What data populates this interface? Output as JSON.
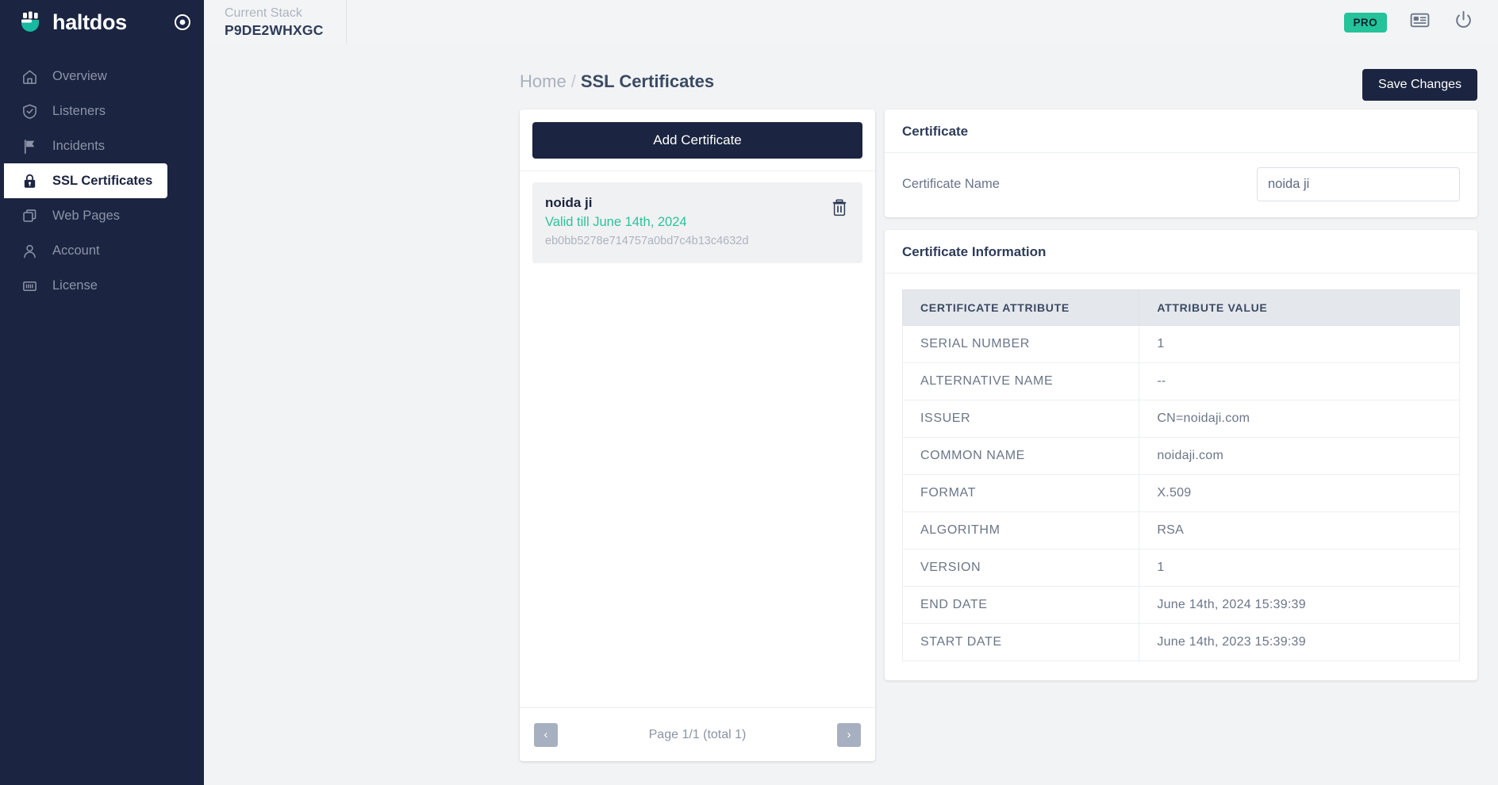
{
  "brand": {
    "name": "haltdos",
    "target_icon": "target-icon"
  },
  "sidebar": {
    "items": [
      {
        "label": "Overview",
        "icon": "home-icon",
        "active": false
      },
      {
        "label": "Listeners",
        "icon": "shield-check-icon",
        "active": false
      },
      {
        "label": "Incidents",
        "icon": "flag-icon",
        "active": false
      },
      {
        "label": "SSL Certificates",
        "icon": "lock-icon",
        "active": true
      },
      {
        "label": "Web Pages",
        "icon": "windows-icon",
        "active": false
      },
      {
        "label": "Account",
        "icon": "person-icon",
        "active": false
      },
      {
        "label": "License",
        "icon": "id-card-icon",
        "active": false
      }
    ]
  },
  "topbar": {
    "stack_label": "Current Stack",
    "stack_value": "P9DE2WHXGC",
    "pro_badge": "PRO",
    "icons": [
      "id-card-icon",
      "power-icon"
    ]
  },
  "breadcrumb": {
    "home": "Home",
    "separator": "/",
    "current": "SSL Certificates"
  },
  "cert_panel": {
    "add_button": "Add Certificate",
    "items": [
      {
        "name": "noida ji",
        "validity": "Valid till June 14th, 2024",
        "hash": "eb0bb5278e714757a0bd7c4b13c4632d",
        "delete_icon": "trash-icon"
      }
    ],
    "pager": {
      "prev": "‹",
      "next": "›",
      "text": "Page 1/1 (total 1)"
    }
  },
  "actions": {
    "save_changes": "Save Changes"
  },
  "certificate_panel": {
    "title": "Certificate",
    "name_label": "Certificate Name",
    "name_value": "noida ji",
    "name_placeholder": "Certificate Name"
  },
  "certificate_information": {
    "title": "Certificate Information",
    "columns": [
      "CERTIFICATE ATTRIBUTE",
      "ATTRIBUTE VALUE"
    ],
    "rows": [
      {
        "attribute": "SERIAL NUMBER",
        "value": "1"
      },
      {
        "attribute": "ALTERNATIVE NAME",
        "value": "--"
      },
      {
        "attribute": "ISSUER",
        "value": "CN=noidaji.com"
      },
      {
        "attribute": "COMMON NAME",
        "value": "noidaji.com"
      },
      {
        "attribute": "FORMAT",
        "value": "X.509"
      },
      {
        "attribute": "ALGORITHM",
        "value": "RSA"
      },
      {
        "attribute": "VERSION",
        "value": "1"
      },
      {
        "attribute": "END DATE",
        "value": "June 14th, 2024 15:39:39"
      },
      {
        "attribute": "START DATE",
        "value": "June 14th, 2023 15:39:39"
      }
    ]
  },
  "colors": {
    "sidebar_bg": "#1b2440",
    "accent_teal": "#24c39a",
    "valid_green": "#2bc39b",
    "page_bg": "#f2f3f5",
    "dark_button": "#1b2440"
  }
}
